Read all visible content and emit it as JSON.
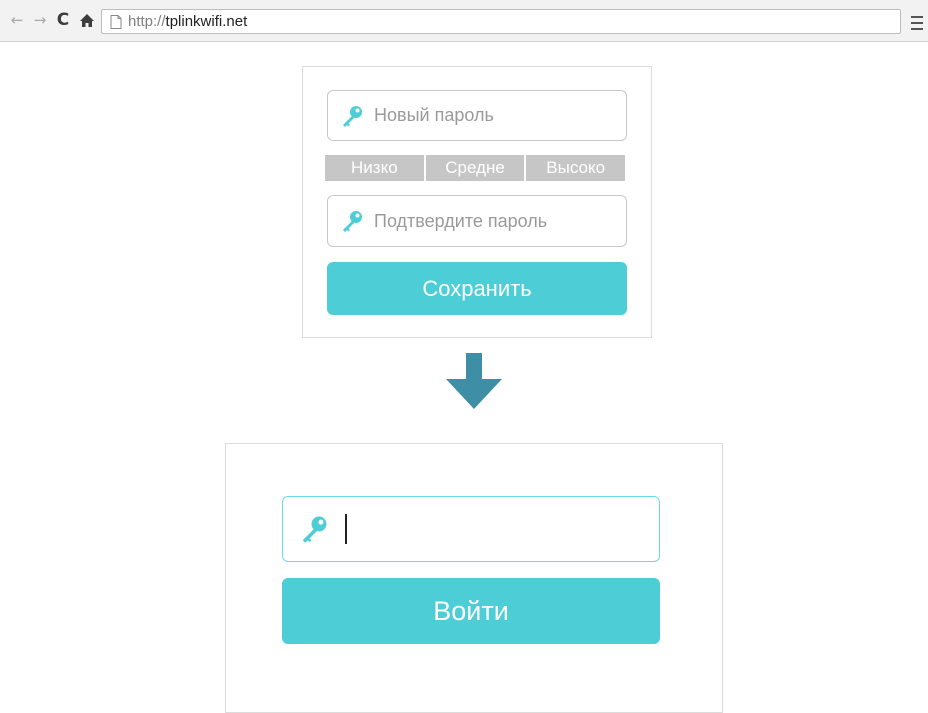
{
  "browser": {
    "back_icon": "←",
    "forward_icon": "→",
    "reload_icon": "C",
    "home_icon": "home-icon",
    "url_scheme": "http://",
    "url_host": "tplinkwifi.net",
    "menu_icon": "hamburger-menu-icon"
  },
  "password_form": {
    "new_password_placeholder": "Новый пароль",
    "strength_levels": [
      "Низко",
      "Средне",
      "Высоко"
    ],
    "confirm_password_placeholder": "Подтвердите пароль",
    "save_label": "Сохранить"
  },
  "login_form": {
    "password_value": "",
    "login_label": "Войти"
  },
  "colors": {
    "accent": "#4dcdd6",
    "key_icon": "#4dcdd6",
    "arrow": "#3e8fa6",
    "strength_bar": "#c6c6c6"
  }
}
